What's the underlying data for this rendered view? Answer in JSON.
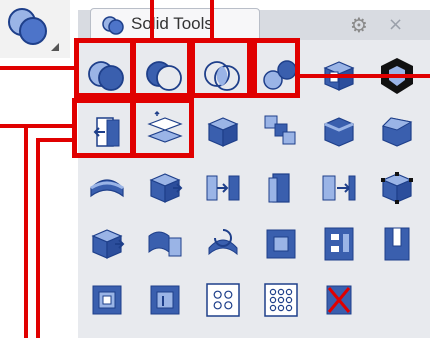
{
  "panel": {
    "tab_label": "Solid Tools",
    "gear_glyph": "⚙",
    "close_glyph": "×"
  },
  "tools": [
    {
      "icon": "boolean-union-icon"
    },
    {
      "icon": "boolean-difference-icon"
    },
    {
      "icon": "boolean-intersection-icon"
    },
    {
      "icon": "boolean-split-icon"
    },
    {
      "icon": "cap-planar-holes-icon"
    },
    {
      "icon": "extract-surface-icon"
    },
    {
      "icon": "extrude-face-icon"
    },
    {
      "icon": "offset-surface-icon"
    },
    {
      "icon": "box-icon"
    },
    {
      "icon": "merge-faces-icon"
    },
    {
      "icon": "fillet-edges-icon"
    },
    {
      "icon": "chamfer-edges-icon"
    },
    {
      "icon": "variable-fillet-icon"
    },
    {
      "icon": "move-face-icon"
    },
    {
      "icon": "move-face-to-boundary-icon"
    },
    {
      "icon": "edit-face-icon"
    },
    {
      "icon": "move-edge-icon"
    },
    {
      "icon": "select-points-icon"
    },
    {
      "icon": "extrude-subobject-icon"
    },
    {
      "icon": "pipe-icon"
    },
    {
      "icon": "rotate-face-icon"
    },
    {
      "icon": "create-hole-icon"
    },
    {
      "icon": "array-holes-icon"
    },
    {
      "icon": "round-hole-icon"
    },
    {
      "icon": "place-hole-icon"
    },
    {
      "icon": "revolve-hole-icon"
    },
    {
      "icon": "array-circle-holes-icon"
    },
    {
      "icon": "array-grid-holes-icon"
    },
    {
      "icon": "delete-hole-icon"
    }
  ],
  "colors": {
    "highlight": "#e00000",
    "icon_blue": "#3a5fae",
    "icon_light": "#9ab4e6"
  }
}
